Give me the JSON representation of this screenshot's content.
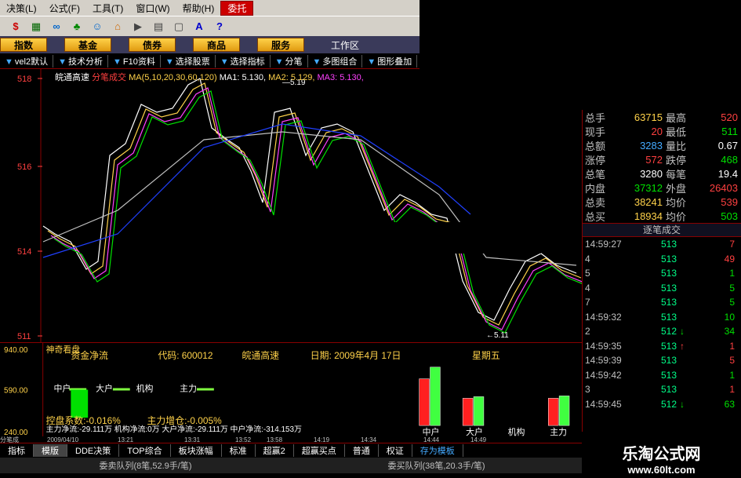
{
  "menu": [
    "决策(L)",
    "公式(F)",
    "工具(T)",
    "窗口(W)",
    "帮助(H)",
    "委托"
  ],
  "toolbar_icons": [
    "dollar-icon",
    "calc-icon",
    "binoculars-icon",
    "tree-icon",
    "person-icon",
    "home-icon",
    "video-icon",
    "grid-icon",
    "window-icon",
    "font-icon",
    "help-icon"
  ],
  "tabs": [
    "指数",
    "基金",
    "债券",
    "商品",
    "服务"
  ],
  "workspace_label": "工作区",
  "funcbar": [
    "vel2默认",
    "技术分析",
    "F10资料",
    "选择股票",
    "选择指标",
    "分笔",
    "多图组合",
    "图形叠加"
  ],
  "chart": {
    "stock_name": "皖通高速",
    "stock_mode": "分笔成交",
    "ma_label": "MA(5,10,20,30,60,120)",
    "ma1": "MA1: 5.130,",
    "ma2": "MA2: 5.129,",
    "ma3": "MA3: 5.130,",
    "y_labels": [
      "518",
      "516",
      "514",
      "511"
    ],
    "annot_high": "—5.19",
    "annot_low": "←5.11"
  },
  "lower": {
    "title": "神奇看盘",
    "fund_label": "资金净流",
    "code_label": "代码: 600012",
    "name_label": "皖通高速",
    "date_label": "日期: 2009年4月 17日",
    "weekday": "星期五",
    "y_labels": [
      "940.00",
      "590.00",
      "240.00"
    ],
    "legend": [
      "中户",
      "大户",
      "机构",
      "主力"
    ],
    "control": "控盘系数:-0.016%",
    "main_add": "主力增仓:-0.005%",
    "flow_line": "主力净流:-29.111万   机构净流:0万   大户净流:-29.111万   中户净流:-314.153万",
    "bar_labels": [
      "中户",
      "大户",
      "机构",
      "主力"
    ]
  },
  "time_axis": [
    "分笔成",
    "2009/04/10",
    "13:21",
    "13:31",
    "13:52",
    "13:58",
    "14:19",
    "14:34",
    "14:44",
    "14:49"
  ],
  "quote": [
    {
      "l": "总手",
      "v": "63715",
      "vc": "#ffd24a",
      "l2": "最高",
      "v2": "520",
      "v2c": "#ff4040"
    },
    {
      "l": "现手",
      "v": "20",
      "vc": "#ff4040",
      "l2": "最低",
      "v2": "511",
      "v2c": "#00e000"
    },
    {
      "l": "总额",
      "v": "3283",
      "vc": "#4af",
      "l2": "量比",
      "v2": "0.67",
      "v2c": "#fff"
    },
    {
      "l": "涨停",
      "v": "572",
      "vc": "#ff4040",
      "l2": "跌停",
      "v2": "468",
      "v2c": "#00e000"
    },
    {
      "l": "总笔",
      "v": "3280",
      "vc": "#fff",
      "l2": "每笔",
      "v2": "19.4",
      "v2c": "#fff"
    },
    {
      "l": "内盘",
      "v": "37312",
      "vc": "#00e000",
      "l2": "外盘",
      "v2": "26403",
      "v2c": "#ff4040"
    },
    {
      "l": "总卖",
      "v": "38241",
      "vc": "#ffd24a",
      "l2": "均价",
      "v2": "539",
      "v2c": "#ff4040"
    },
    {
      "l": "总买",
      "v": "18934",
      "vc": "#ffd24a",
      "l2": "均价",
      "v2": "503",
      "v2c": "#00e000"
    }
  ],
  "deals_title": "逐笔成交",
  "deals": [
    {
      "t": "14:59:27",
      "p": "513",
      "a": "",
      "q": "7",
      "qc": "#ff4040"
    },
    {
      "t": "4",
      "p": "513",
      "a": "",
      "q": "49",
      "qc": "#ff4040"
    },
    {
      "t": "5",
      "p": "513",
      "a": "",
      "q": "1",
      "qc": "#00e000"
    },
    {
      "t": "4",
      "p": "513",
      "a": "",
      "q": "5",
      "qc": "#00e000"
    },
    {
      "t": "7",
      "p": "513",
      "a": "",
      "q": "5",
      "qc": "#00e000"
    },
    {
      "t": "14:59:32",
      "p": "513",
      "a": "",
      "q": "10",
      "qc": "#00e000"
    },
    {
      "t": "2",
      "p": "512",
      "a": "↓",
      "q": "34",
      "qc": "#00e000"
    },
    {
      "t": "14:59:35",
      "p": "513",
      "a": "↑",
      "q": "1",
      "qc": "#ff4040"
    },
    {
      "t": "14:59:39",
      "p": "513",
      "a": "",
      "q": "5",
      "qc": "#ff4040"
    },
    {
      "t": "14:59:42",
      "p": "513",
      "a": "",
      "q": "1",
      "qc": "#00e000"
    },
    {
      "t": "3",
      "p": "513",
      "a": "",
      "q": "1",
      "qc": "#ff4040"
    },
    {
      "t": "14:59:45",
      "p": "512",
      "a": "↓",
      "q": "63",
      "qc": "#00e000"
    }
  ],
  "bottom_tabs": [
    "指标",
    "模版",
    "DDE决策",
    "TOP综合",
    "板块涨幅",
    "标准",
    "超赢2",
    "超赢买点",
    "普通",
    "权证",
    "存为模板"
  ],
  "queues": [
    "委卖队列(8笔,52.9手/笔)",
    "委买队列(38笔,20.3手/笔)"
  ],
  "watermark": {
    "line1": "乐淘公式网",
    "line2": "www.60lt.com"
  }
}
